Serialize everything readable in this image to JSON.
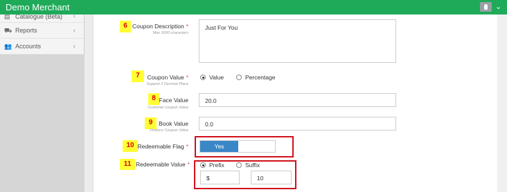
{
  "topbar": {
    "title": "Demo Merchant"
  },
  "sidebar": {
    "items": [
      {
        "label": "Catalogue (Beta)"
      },
      {
        "label": "Reports"
      },
      {
        "label": "Accounts"
      }
    ]
  },
  "form": {
    "coupon_description": {
      "badge": "6",
      "label": "Coupon Description",
      "hint": "Max 3000 characters",
      "value": "Just For You"
    },
    "coupon_value": {
      "badge": "7",
      "label": "Coupon Value",
      "hint": "Support 2 Decimal Place",
      "options": [
        "Value",
        "Percentage"
      ],
      "selected": "Value"
    },
    "face_value": {
      "badge": "8",
      "label": "Face Value",
      "hint": "Customer coupon Value",
      "value": "20.0"
    },
    "book_value": {
      "badge": "9",
      "label": "Book Value",
      "hint": "Finance Coupon Value",
      "value": "0.0"
    },
    "redeemable_flag": {
      "badge": "10",
      "label": "Redeemable Flag",
      "value": "Yes"
    },
    "redeemable_value": {
      "badge": "11",
      "label": "Redeemable Value",
      "options": [
        "Prefix",
        "Suffix"
      ],
      "selected": "Prefix",
      "symbol": "$",
      "amount": "10"
    }
  },
  "colors": {
    "topbar": "#1faa5a",
    "required": "#e04848",
    "badge_bg": "#ffff33",
    "badge_text": "#dd0000",
    "highlight_box": "#d0101a",
    "toggle_on": "#3a87c8"
  }
}
